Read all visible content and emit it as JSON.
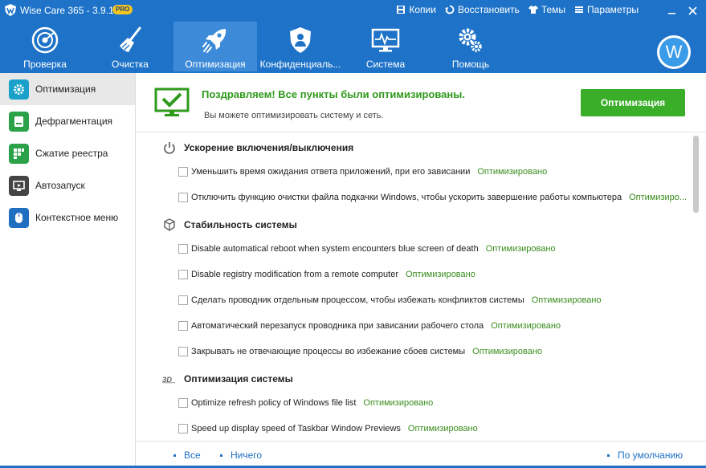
{
  "app": {
    "title": "Wise Care 365 - 3.9.1",
    "badge": "PRO",
    "colors": {
      "header": "#1e73c8",
      "active_tab": "#3d8bd8",
      "accent_green": "#3aae29",
      "link_blue": "#1e6fc2"
    }
  },
  "title_actions": [
    {
      "label": "Копии",
      "icon": "backup-icon"
    },
    {
      "label": "Восстановить",
      "icon": "restore-icon"
    },
    {
      "label": "Темы",
      "icon": "shirt-icon"
    },
    {
      "label": "Параметры",
      "icon": "menu-icon"
    }
  ],
  "nav": [
    {
      "label": "Проверка",
      "icon": "radar-icon",
      "active": false
    },
    {
      "label": "Очистка",
      "icon": "broom-icon",
      "active": false
    },
    {
      "label": "Оптимизация",
      "icon": "rocket-icon",
      "active": true
    },
    {
      "label": "Конфиденциаль...",
      "icon": "shield-user-icon",
      "active": false
    },
    {
      "label": "Система",
      "icon": "monitor-icon",
      "active": false
    },
    {
      "label": "Помощь",
      "icon": "gears-icon",
      "active": false
    }
  ],
  "user": {
    "avatar_letter": "W"
  },
  "sidebar": [
    {
      "label": "Оптимизация",
      "icon": "gear-icon",
      "color": "#1aa1c9",
      "active": true
    },
    {
      "label": "Дефрагментация",
      "icon": "disk-icon",
      "color": "#2ba24a",
      "active": false
    },
    {
      "label": "Сжатие реестра",
      "icon": "registry-icon",
      "color": "#2ba24a",
      "active": false
    },
    {
      "label": "Автозапуск",
      "icon": "startup-monitor-icon",
      "color": "#444444",
      "active": false
    },
    {
      "label": "Контекстное меню",
      "icon": "mouse-icon",
      "color": "#1f6fc0",
      "active": false
    }
  ],
  "banner": {
    "title": "Поздравляем! Все пункты были оптимизированы.",
    "subtitle": "Вы можете оптимизировать систему и сеть.",
    "button": "Оптимизация"
  },
  "sections": [
    {
      "title": "Ускорение включения/выключения",
      "icon": "power-icon",
      "items": [
        {
          "text": "Уменьшить время ожидания ответа приложений, при его зависании",
          "status": "Оптимизировано"
        },
        {
          "text": "Отключить функцию очистки файла подкачки Windows, чтобы ускорить завершение работы компьютера",
          "status": "Оптимизиро..."
        }
      ]
    },
    {
      "title": "Стабильность системы",
      "icon": "cube-icon",
      "items": [
        {
          "text": "Disable automatical reboot when system encounters blue screen of death",
          "status": "Оптимизировано"
        },
        {
          "text": "Disable registry modification from a remote computer",
          "status": "Оптимизировано"
        },
        {
          "text": "Сделать проводник отдельным процессом, чтобы избежать конфликтов системы",
          "status": "Оптимизировано"
        },
        {
          "text": "Автоматический перезапуск проводника при зависании рабочего стола",
          "status": "Оптимизировано"
        },
        {
          "text": "Закрывать не отвечающие процессы во избежание сбоев системы",
          "status": "Оптимизировано"
        }
      ]
    },
    {
      "title": "Оптимизация системы",
      "icon": "3d-icon",
      "items": [
        {
          "text": "Optimize refresh policy of Windows file list",
          "status": "Оптимизировано"
        },
        {
          "text": "Speed up display speed of Taskbar Window Previews",
          "status": "Оптимизировано"
        }
      ]
    }
  ],
  "footer": {
    "all": "Все",
    "none": "Ничего",
    "default": "По умолчанию"
  }
}
